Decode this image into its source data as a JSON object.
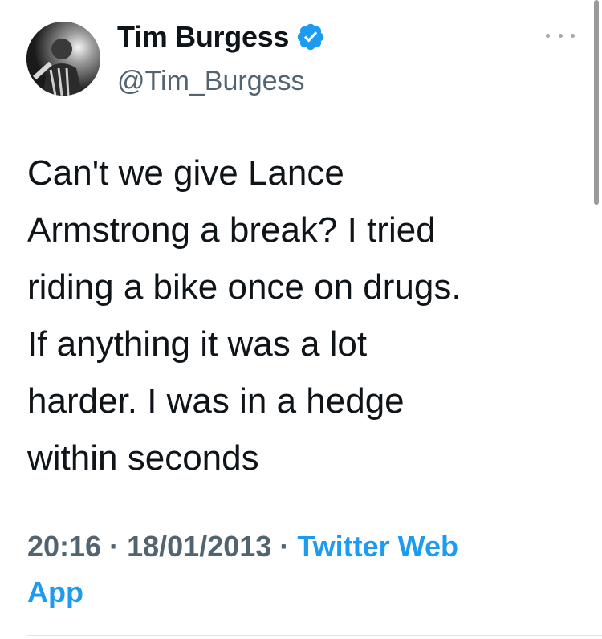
{
  "author": {
    "display_name": "Tim Burgess",
    "handle": "@Tim_Burgess",
    "verified": true,
    "avatar_icon": "profile-photo"
  },
  "tweet": {
    "text_lines": [
      "Can't we give Lance",
      "Armstrong a break? I tried",
      "riding a bike once on drugs.",
      "If anything it was a lot",
      "harder. I was in a hedge",
      "within seconds"
    ],
    "time": "20:16",
    "separator": "·",
    "date": "18/01/2013",
    "source_line1": "Twitter Web",
    "source_line2": "App"
  },
  "colors": {
    "text": "#0f1419",
    "secondary": "#536471",
    "link": "#1d9bf0",
    "verified": "#1d9bf0"
  },
  "icons": {
    "more": "more-horizontal-icon",
    "verified": "verified-badge-icon"
  }
}
